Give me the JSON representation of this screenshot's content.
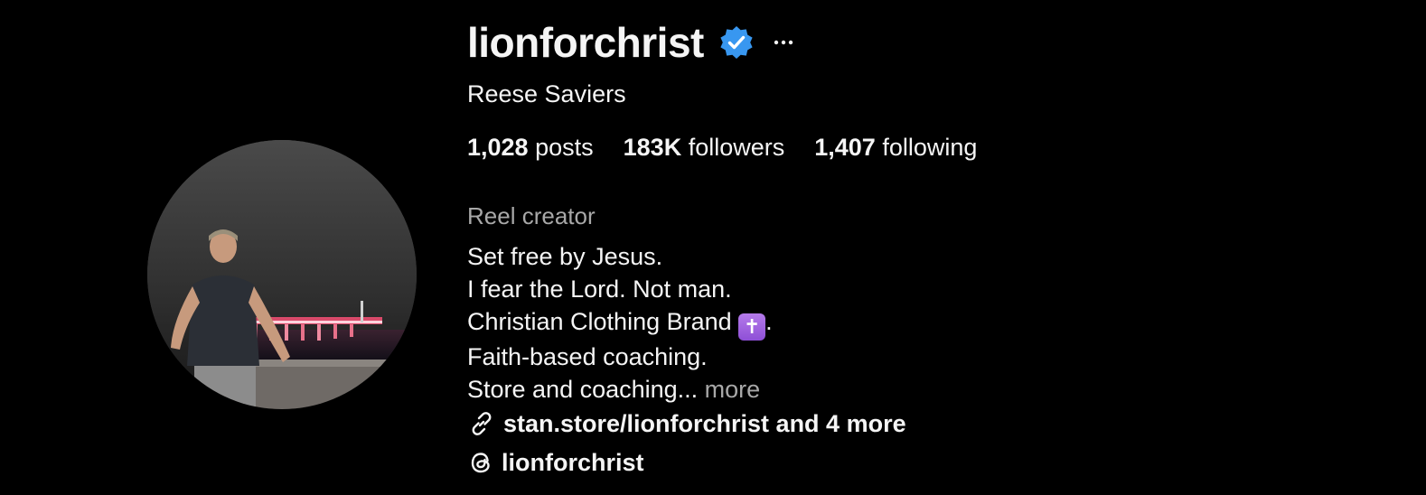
{
  "profile": {
    "username": "lionforchrist",
    "verified": true,
    "full_name": "Reese Saviers",
    "stats": {
      "posts_count": "1,028",
      "posts_label": "posts",
      "followers_count": "183K",
      "followers_label": "followers",
      "following_count": "1,407",
      "following_label": "following"
    },
    "category": "Reel creator",
    "bio": {
      "line1": "Set free by Jesus.",
      "line2": "I fear the Lord. Not man.",
      "line3_text": "Christian Clothing Brand ",
      "line3_emoji": "✝",
      "line3_end": ".",
      "line4": "Faith-based coaching.",
      "line5": "Store and coaching... ",
      "more_label": "more"
    },
    "link": {
      "text": "stan.store/lionforchrist and 4 more",
      "icon": "link-icon"
    },
    "threads": {
      "handle": "lionforchrist",
      "icon": "threads-icon"
    }
  },
  "colors": {
    "background": "#000000",
    "text": "#f5f5f5",
    "secondary_text": "#a8a8a8",
    "verified_badge": "#3897f0"
  }
}
